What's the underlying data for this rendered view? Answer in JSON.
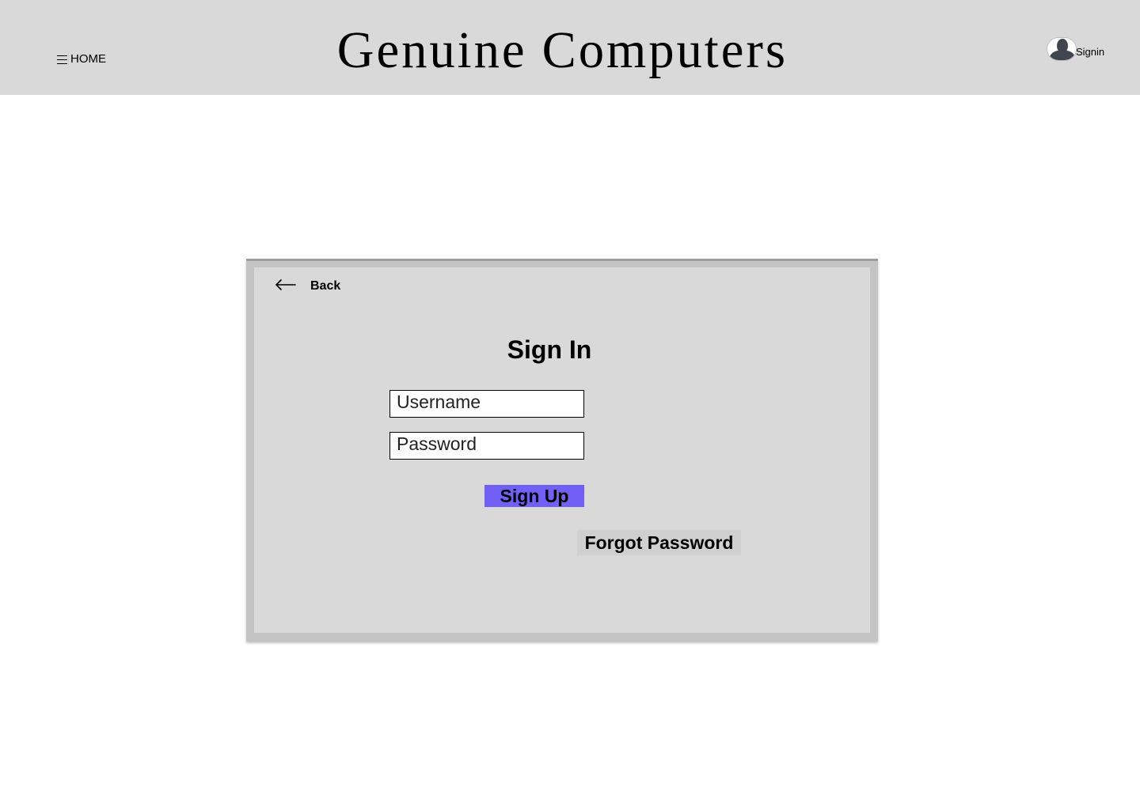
{
  "header": {
    "menu_label": "HOME",
    "brand_title": "Genuine Computers",
    "signin_label": "Signin",
    "icons": [
      "hamburger-icon",
      "avatar-icon"
    ]
  },
  "card": {
    "back_label": "Back",
    "title": "Sign In",
    "username": {
      "placeholder": "Username",
      "value": ""
    },
    "password": {
      "placeholder": "Password",
      "value": ""
    },
    "signup_label": "Sign Up",
    "forgot_label": "Forgot Password",
    "icons": [
      "arrow-left-icon"
    ]
  },
  "colors": {
    "header_bg": "#d9d9d9",
    "card_bg": "#d9d9d9",
    "card_frame": "#c4c4c4",
    "signup_button": "#7060f5"
  }
}
